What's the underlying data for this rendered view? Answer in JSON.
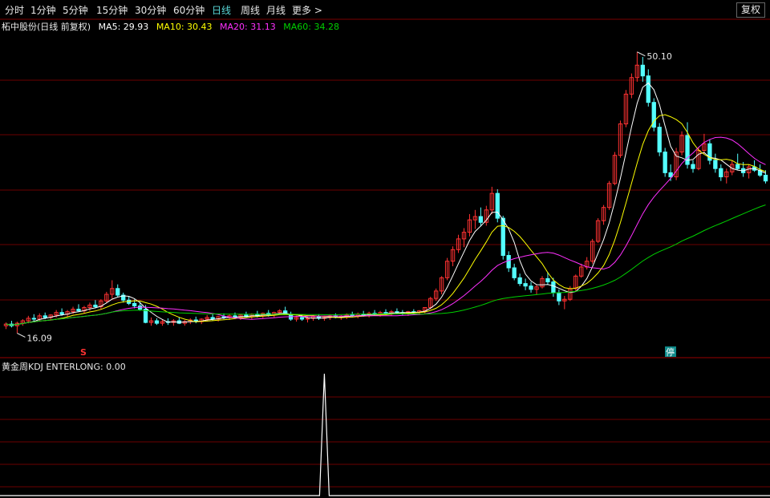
{
  "toolbar": {
    "periods": [
      "分时",
      "1分钟",
      "5分钟",
      "15分钟",
      "30分钟",
      "60分钟",
      "日线",
      "周线",
      "月线",
      "更多 >"
    ],
    "active_index": 6,
    "fuquan": "复权"
  },
  "header": {
    "title": "柘中股份(日线 前复权)",
    "ma5": "MA5: 29.93",
    "ma10": "MA10: 30.43",
    "ma20": "MA20: 31.13",
    "ma60": "MA60: 34.28"
  },
  "indicator": {
    "label": "黄金周KDJ ENTERLONG: 0.00"
  },
  "markers": {
    "high": "50.10",
    "low": "16.09",
    "buy_signal": "S",
    "stop": "停"
  },
  "colors": {
    "up": "#ff3232",
    "down": "#54ffff",
    "ma5": "#ffffff",
    "ma10": "#ffff00",
    "ma20": "#ff30ff",
    "ma60": "#00d000",
    "grid": "#6b0000",
    "text": "#e8e8e8"
  },
  "chart_data": {
    "type": "candlestick",
    "price_range": [
      14.5,
      52.5
    ],
    "high": 50.1,
    "low": 16.09,
    "ohlc": [
      [
        17.0,
        17.4,
        16.6,
        17.2
      ],
      [
        17.2,
        17.6,
        16.8,
        17.0
      ],
      [
        17.0,
        17.5,
        16.1,
        17.3
      ],
      [
        17.3,
        17.8,
        17.0,
        17.6
      ],
      [
        17.6,
        18.2,
        17.3,
        17.9
      ],
      [
        17.9,
        18.4,
        17.5,
        17.8
      ],
      [
        17.8,
        18.5,
        17.6,
        18.2
      ],
      [
        18.2,
        18.6,
        17.8,
        18.0
      ],
      [
        18.0,
        18.4,
        17.6,
        18.3
      ],
      [
        18.3,
        18.9,
        18.0,
        18.6
      ],
      [
        18.6,
        19.1,
        18.2,
        18.4
      ],
      [
        18.4,
        18.9,
        18.1,
        18.7
      ],
      [
        18.7,
        19.3,
        18.4,
        19.0
      ],
      [
        19.0,
        19.6,
        18.7,
        18.8
      ],
      [
        18.8,
        19.4,
        18.5,
        19.2
      ],
      [
        19.2,
        19.8,
        18.8,
        19.5
      ],
      [
        19.5,
        20.1,
        19.1,
        19.3
      ],
      [
        19.3,
        20.2,
        19.0,
        20.0
      ],
      [
        20.0,
        21.1,
        19.7,
        20.8
      ],
      [
        20.8,
        22.5,
        20.3,
        21.5
      ],
      [
        21.5,
        22.0,
        20.5,
        20.7
      ],
      [
        20.7,
        21.0,
        19.8,
        20.1
      ],
      [
        20.1,
        20.6,
        19.5,
        19.7
      ],
      [
        19.7,
        20.2,
        19.1,
        19.4
      ],
      [
        19.4,
        19.9,
        18.8,
        19.0
      ],
      [
        19.0,
        19.5,
        17.3,
        17.4
      ],
      [
        17.4,
        18.0,
        17.0,
        17.6
      ],
      [
        17.6,
        17.9,
        17.1,
        17.3
      ],
      [
        17.3,
        17.8,
        17.0,
        17.5
      ],
      [
        17.5,
        17.9,
        17.1,
        17.4
      ],
      [
        17.4,
        17.8,
        17.0,
        17.6
      ],
      [
        17.6,
        18.0,
        17.2,
        17.3
      ],
      [
        17.3,
        17.7,
        17.0,
        17.5
      ],
      [
        17.5,
        17.9,
        17.2,
        17.7
      ],
      [
        17.7,
        18.1,
        17.3,
        17.5
      ],
      [
        17.5,
        17.9,
        17.2,
        17.8
      ],
      [
        17.8,
        18.3,
        17.5,
        18.0
      ],
      [
        18.0,
        18.4,
        17.6,
        17.8
      ],
      [
        17.8,
        18.2,
        17.5,
        18.1
      ],
      [
        18.1,
        18.5,
        17.8,
        18.0
      ],
      [
        18.0,
        18.4,
        17.7,
        18.2
      ],
      [
        18.2,
        18.6,
        17.8,
        18.0
      ],
      [
        18.0,
        18.4,
        17.7,
        18.3
      ],
      [
        18.3,
        18.7,
        18.0,
        18.1
      ],
      [
        18.1,
        18.5,
        17.8,
        18.4
      ],
      [
        18.4,
        18.8,
        18.0,
        18.2
      ],
      [
        18.2,
        18.6,
        17.9,
        18.5
      ],
      [
        18.5,
        18.9,
        18.1,
        18.3
      ],
      [
        18.3,
        18.7,
        18.0,
        18.6
      ],
      [
        18.6,
        19.0,
        18.3,
        18.8
      ],
      [
        18.8,
        19.3,
        18.5,
        18.4
      ],
      [
        18.4,
        18.7,
        17.6,
        17.8
      ],
      [
        17.8,
        18.2,
        17.5,
        18.0
      ],
      [
        18.0,
        18.3,
        17.6,
        17.8
      ],
      [
        17.8,
        18.1,
        17.4,
        17.9
      ],
      [
        17.9,
        18.3,
        17.6,
        18.1
      ],
      [
        18.1,
        18.4,
        17.7,
        17.9
      ],
      [
        17.9,
        18.2,
        17.6,
        18.0
      ],
      [
        18.0,
        18.4,
        17.7,
        18.2
      ],
      [
        18.2,
        18.5,
        17.9,
        18.0
      ],
      [
        18.0,
        18.3,
        17.7,
        18.1
      ],
      [
        18.1,
        18.5,
        17.8,
        18.3
      ],
      [
        18.3,
        18.7,
        18.0,
        18.2
      ],
      [
        18.2,
        18.6,
        17.9,
        18.4
      ],
      [
        18.4,
        18.8,
        18.1,
        18.3
      ],
      [
        18.3,
        18.7,
        18.0,
        18.5
      ],
      [
        18.5,
        18.9,
        18.2,
        18.4
      ],
      [
        18.4,
        18.8,
        18.1,
        18.6
      ],
      [
        18.6,
        19.0,
        18.3,
        18.5
      ],
      [
        18.5,
        18.9,
        18.2,
        18.7
      ],
      [
        18.7,
        19.1,
        18.4,
        18.6
      ],
      [
        18.6,
        18.9,
        18.3,
        18.5
      ],
      [
        18.5,
        18.8,
        18.2,
        18.7
      ],
      [
        18.7,
        19.0,
        18.4,
        18.6
      ],
      [
        18.6,
        18.9,
        18.3,
        18.8
      ],
      [
        18.8,
        19.2,
        18.5,
        19.2
      ],
      [
        19.2,
        20.5,
        19.0,
        20.3
      ],
      [
        20.3,
        21.5,
        20.0,
        21.2
      ],
      [
        21.2,
        23.0,
        20.8,
        22.8
      ],
      [
        22.8,
        25.2,
        22.5,
        24.8
      ],
      [
        24.8,
        26.6,
        24.2,
        26.2
      ],
      [
        26.2,
        28.0,
        25.8,
        27.5
      ],
      [
        27.5,
        28.8,
        26.5,
        28.3
      ],
      [
        28.3,
        30.5,
        27.8,
        29.8
      ],
      [
        29.8,
        31.0,
        28.7,
        30.2
      ],
      [
        30.2,
        31.3,
        29.0,
        29.5
      ],
      [
        29.5,
        31.5,
        29.1,
        31.0
      ],
      [
        31.0,
        33.8,
        30.5,
        33.0
      ],
      [
        33.0,
        33.5,
        29.5,
        30.0
      ],
      [
        30.0,
        30.3,
        25.0,
        25.5
      ],
      [
        25.5,
        26.0,
        23.5,
        24.0
      ],
      [
        24.0,
        24.5,
        22.5,
        22.8
      ],
      [
        22.8,
        23.3,
        21.8,
        22.1
      ],
      [
        22.1,
        22.7,
        21.3,
        21.8
      ],
      [
        21.8,
        22.3,
        21.0,
        21.4
      ],
      [
        21.4,
        22.0,
        20.8,
        21.7
      ],
      [
        21.7,
        23.0,
        21.5,
        22.7
      ],
      [
        22.7,
        23.5,
        22.0,
        22.3
      ],
      [
        22.3,
        22.8,
        20.5,
        21.0
      ],
      [
        21.0,
        21.4,
        19.5,
        20.0
      ],
      [
        20.0,
        20.6,
        19.0,
        20.2
      ],
      [
        20.2,
        21.8,
        20.0,
        21.5
      ],
      [
        21.5,
        23.2,
        21.2,
        23.0
      ],
      [
        23.0,
        24.5,
        22.8,
        24.1
      ],
      [
        24.1,
        25.3,
        23.8,
        24.8
      ],
      [
        24.8,
        27.5,
        24.5,
        27.2
      ],
      [
        27.2,
        30.0,
        27.0,
        29.7
      ],
      [
        29.7,
        31.6,
        29.2,
        31.3
      ],
      [
        31.3,
        34.5,
        31.0,
        34.2
      ],
      [
        34.2,
        38.0,
        34.0,
        37.6
      ],
      [
        37.6,
        41.8,
        37.3,
        41.4
      ],
      [
        41.4,
        45.5,
        41.0,
        45.0
      ],
      [
        45.0,
        47.5,
        44.5,
        47.0
      ],
      [
        47.0,
        50.1,
        46.5,
        48.5
      ],
      [
        48.5,
        49.5,
        46.5,
        47.2
      ],
      [
        47.2,
        48.0,
        43.5,
        44.0
      ],
      [
        44.0,
        44.5,
        40.5,
        41.0
      ],
      [
        41.0,
        41.5,
        37.5,
        38.0
      ],
      [
        38.0,
        38.5,
        35.0,
        35.5
      ],
      [
        35.5,
        36.5,
        34.5,
        35.0
      ],
      [
        35.0,
        38.5,
        34.6,
        38.0
      ],
      [
        38.0,
        40.5,
        37.6,
        40.0
      ],
      [
        40.0,
        41.6,
        36.0,
        36.5
      ],
      [
        36.5,
        37.0,
        35.5,
        36.0
      ],
      [
        36.0,
        38.6,
        35.8,
        38.2
      ],
      [
        38.2,
        40.2,
        37.8,
        39.0
      ],
      [
        39.0,
        39.5,
        36.5,
        37.0
      ],
      [
        37.0,
        37.8,
        35.5,
        36.0
      ],
      [
        36.0,
        36.5,
        34.5,
        35.0
      ],
      [
        35.0,
        36.0,
        34.2,
        35.6
      ],
      [
        35.6,
        37.0,
        35.2,
        36.5
      ],
      [
        36.5,
        37.8,
        35.8,
        36.0
      ],
      [
        36.0,
        36.8,
        35.0,
        35.5
      ],
      [
        35.5,
        36.5,
        34.8,
        36.2
      ],
      [
        36.2,
        37.0,
        35.6,
        35.8
      ],
      [
        35.8,
        36.5,
        35.0,
        35.2
      ],
      [
        35.2,
        35.8,
        34.2,
        34.5
      ]
    ],
    "ma_lines": [
      {
        "name": "MA5",
        "color": "#ffffff"
      },
      {
        "name": "MA10",
        "color": "#ffff00"
      },
      {
        "name": "MA20",
        "color": "#ff30ff"
      },
      {
        "name": "MA60",
        "color": "#00d000"
      }
    ],
    "indicator": {
      "range": [
        0,
        1.2
      ],
      "spike_index": 57,
      "spike_value": 1
    }
  }
}
